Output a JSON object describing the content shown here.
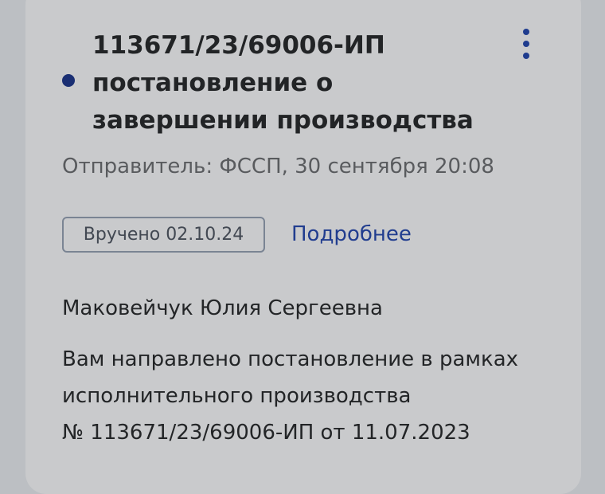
{
  "notification": {
    "title_lines": [
      "113671/23/69006-ИП",
      "постановление о",
      "завершении производства"
    ],
    "sender": "Отправитель: ФССП, 30 сентября 20:08",
    "status_badge": "Вручено 02.10.24",
    "details_link": "Подробнее",
    "recipient": "Маковейчук Юлия Сергеевна",
    "message_lines": [
      "Вам направлено постановление в рамках",
      "исполнительного производства",
      "№ 113671/23/69006-ИП от 11.07.2023"
    ],
    "icons": {
      "unread": "unread-dot-icon",
      "menu": "more-vertical-icon"
    },
    "colors": {
      "accent": "#213d8f",
      "unread_dot": "#1a2f73"
    }
  }
}
